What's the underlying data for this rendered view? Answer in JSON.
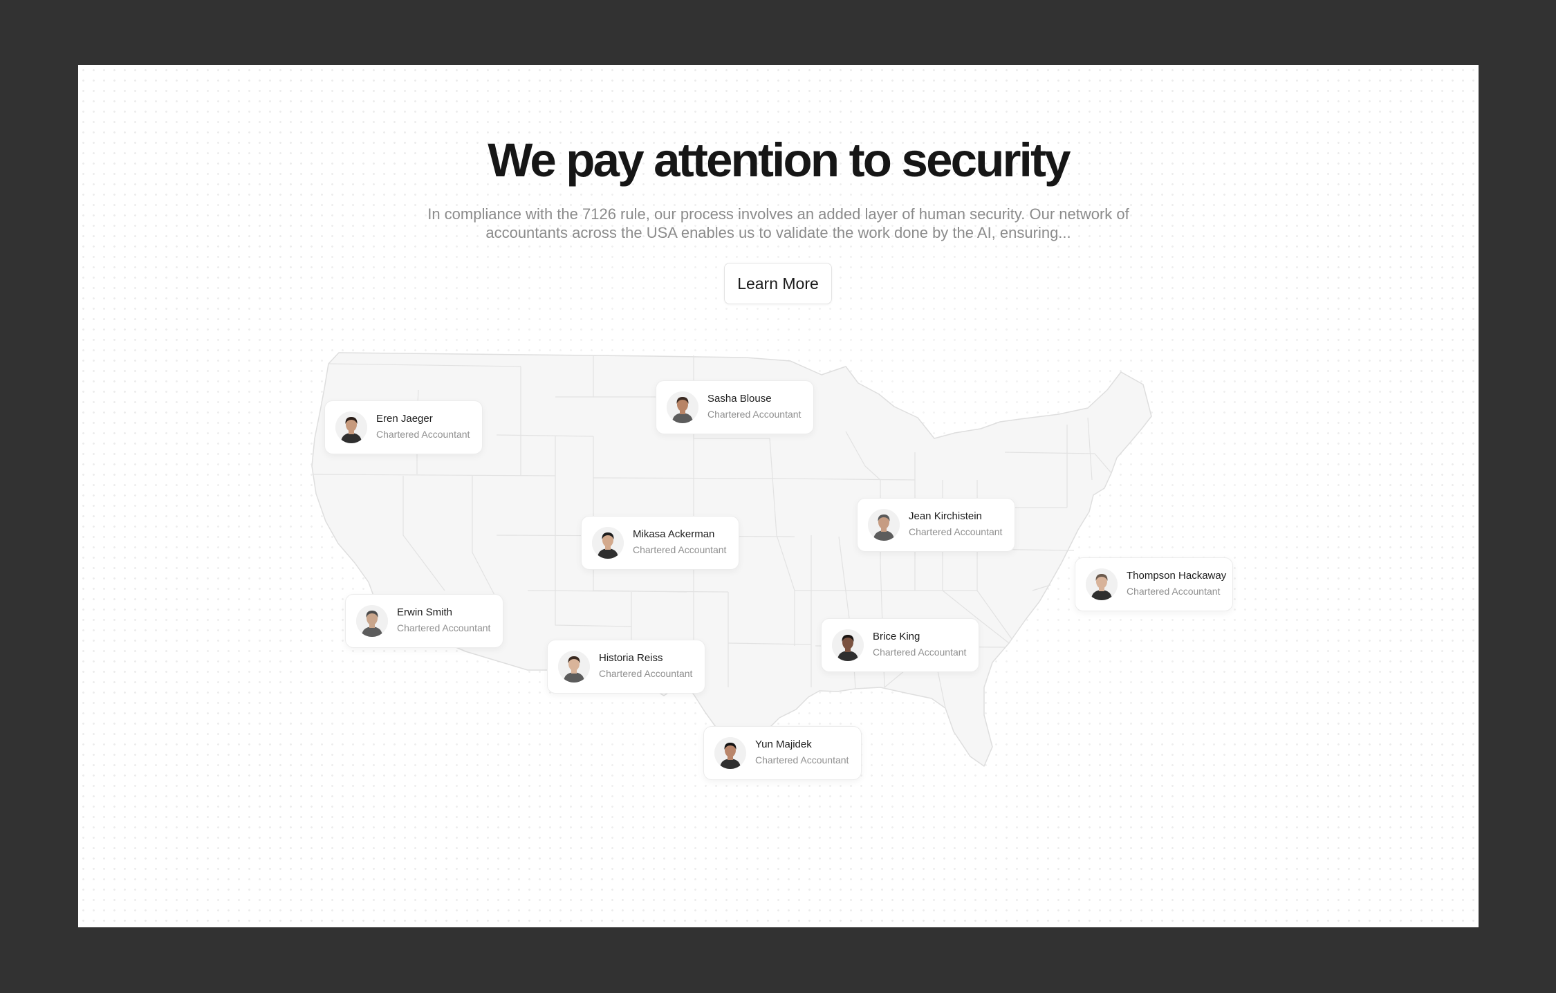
{
  "section": {
    "title": "We pay attention to security",
    "description": "In compliance with the 7126 rule, our process involves an added layer of human security. Our network of accountants across the USA enables us to validate the work done by the AI, ensuring...",
    "cta_label": "Learn More"
  },
  "map": {
    "region": "usa-states-map",
    "fill_color": "#f6f6f6",
    "stroke_color": "#dedede"
  },
  "accountants": [
    {
      "name": "Eren Jaeger",
      "role": "Chartered Accountant",
      "hair": "#2a1d17",
      "skin": "#c79a7d"
    },
    {
      "name": "Sasha Blouse",
      "role": "Chartered Accountant",
      "hair": "#3b2a22",
      "skin": "#b88466"
    },
    {
      "name": "Mikasa Ackerman",
      "role": "Chartered Accountant",
      "hair": "#1e1e1e",
      "skin": "#d3a98c"
    },
    {
      "name": "Jean Kirchistein",
      "role": "Chartered Accountant",
      "hair": "#5a5a5a",
      "skin": "#c69c82"
    },
    {
      "name": "Thompson Hackaway",
      "role": "Chartered Accountant",
      "hair": "#6b5a4d",
      "skin": "#d8b39a"
    },
    {
      "name": "Erwin Smith",
      "role": "Chartered Accountant",
      "hair": "#4a4a4a",
      "skin": "#c9a58b"
    },
    {
      "name": "Brice King",
      "role": "Chartered Accountant",
      "hair": "#1a1412",
      "skin": "#7a5240"
    },
    {
      "name": "Historia Reiss",
      "role": "Chartered Accountant",
      "hair": "#3a2a20",
      "skin": "#d9b49a"
    },
    {
      "name": "Yun Majidek",
      "role": "Chartered Accountant",
      "hair": "#141414",
      "skin": "#b9856a"
    }
  ]
}
